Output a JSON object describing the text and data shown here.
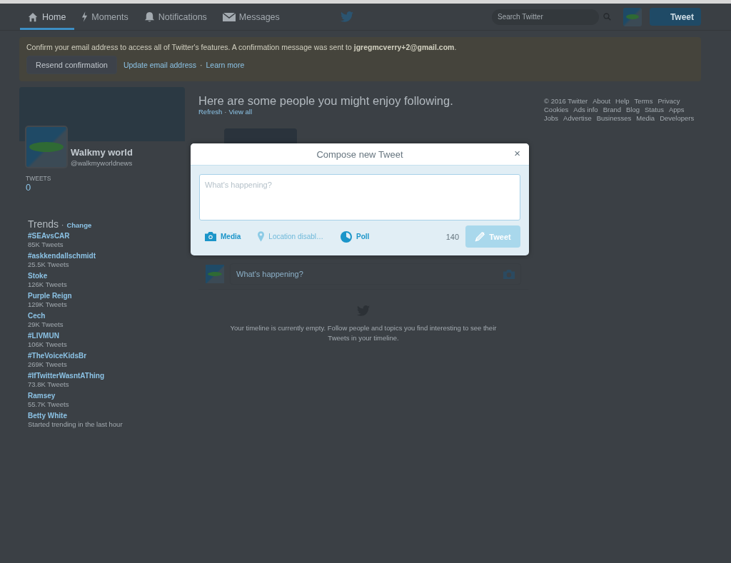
{
  "nav": {
    "items": [
      {
        "kind": "home",
        "label": "Home",
        "selected": true
      },
      {
        "kind": "moments",
        "label": "Moments",
        "selected": false
      },
      {
        "kind": "notifications",
        "label": "Notifications",
        "selected": false
      },
      {
        "kind": "messages",
        "label": "Messages",
        "selected": false
      }
    ],
    "search_placeholder": "Search Twitter",
    "tweet_button": "Tweet"
  },
  "banner": {
    "message": "Confirm your email address to access all of Twitter's features. A confirmation message was sent to **jgregmcverry+2@gmail.com**.",
    "resend_button": "Resend confirmation",
    "links": [
      "Update email address",
      "Learn more"
    ],
    "separator": "·"
  },
  "profile": {
    "name": "Walkmy world",
    "handle": "@walkmyworldnews",
    "stat_label": "TWEETS",
    "stat_value": "0"
  },
  "trends": {
    "title": "Trends",
    "separator": "·",
    "change": "Change",
    "items": [
      {
        "name": "#SEAvsCAR",
        "meta": "85K Tweets"
      },
      {
        "name": "#askkendallschmidt",
        "meta": "25.5K Tweets"
      },
      {
        "name": "Stoke",
        "meta": "126K Tweets"
      },
      {
        "name": "Purple Reign",
        "meta": "129K Tweets"
      },
      {
        "name": "Cech",
        "meta": "29K Tweets"
      },
      {
        "name": "#LIVMUN",
        "meta": "106K Tweets"
      },
      {
        "name": "#TheVoiceKidsBr",
        "meta": "269K Tweets"
      },
      {
        "name": "#IfTwitterWasntAThing",
        "meta": "73.8K Tweets"
      },
      {
        "name": "Ramsey",
        "meta": "55.7K Tweets"
      },
      {
        "name": "Betty White",
        "meta": "Started trending in the last hour"
      }
    ]
  },
  "suggestions": {
    "heading": "Here are some people you might enjoy following.",
    "links": [
      "Refresh",
      "View all"
    ],
    "separator": "·"
  },
  "inline_compose": {
    "placeholder": "What's happening?"
  },
  "empty_timeline": "Your timeline is currently empty. Follow people and topics you find interesting to see their Tweets in your timeline.",
  "footer": [
    "© 2016 Twitter",
    "About",
    "Help",
    "Terms",
    "Privacy",
    "Cookies",
    "Ads info",
    "Brand",
    "Blog",
    "Status",
    "Apps",
    "Jobs",
    "Advertise",
    "Businesses",
    "Media",
    "Developers"
  ],
  "modal": {
    "title": "Compose new Tweet",
    "close": "×",
    "placeholder": "What's happening?",
    "actions": [
      {
        "kind": "media",
        "label": "Media",
        "disabled": false
      },
      {
        "kind": "location",
        "label": "Location disabl…",
        "disabled": true
      },
      {
        "kind": "poll",
        "label": "Poll",
        "disabled": false
      }
    ],
    "counter": "140",
    "tweet_button": "Tweet",
    "tweet_disabled": true
  }
}
